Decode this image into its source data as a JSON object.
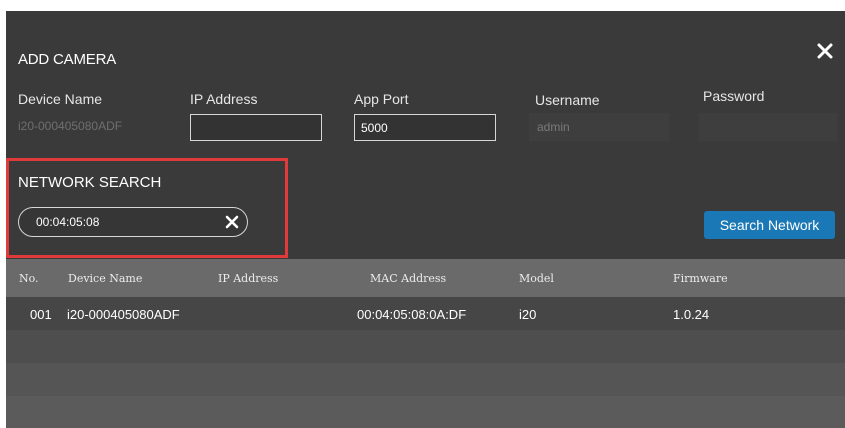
{
  "dialog": {
    "title": "ADD CAMERA",
    "close_icon": "close-icon"
  },
  "fields": {
    "device_name": {
      "label": "Device Name",
      "value": "i20-000405080ADF"
    },
    "ip_address": {
      "label": "IP Address",
      "value": ""
    },
    "app_port": {
      "label": "App Port",
      "value": "5000"
    },
    "username": {
      "label": "Username",
      "value": "admin"
    },
    "password": {
      "label": "Password",
      "value": ""
    }
  },
  "network_search": {
    "title": "NETWORK SEARCH",
    "query": "00:04:05:08",
    "clear_icon": "clear-icon",
    "search_button_label": "Search Network",
    "accent_color": "#1978b5",
    "highlight_color": "#e03a3a"
  },
  "table": {
    "columns": [
      "No.",
      "Device Name",
      "IP Address",
      "MAC Address",
      "Model",
      "Firmware"
    ],
    "rows": [
      {
        "no": "001",
        "device_name": "i20-000405080ADF",
        "ip_address": "",
        "mac_address": "00:04:05:08:0A:DF",
        "model": "i20",
        "firmware": "1.0.24"
      }
    ],
    "row_colors": [
      "#464646",
      "#4e4e4e",
      "#555555",
      "#5b5b5b"
    ]
  }
}
